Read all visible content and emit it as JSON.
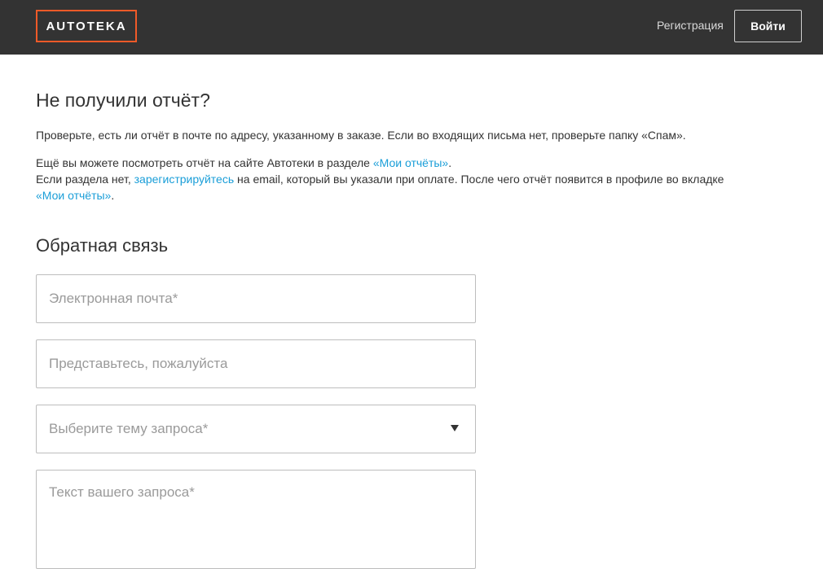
{
  "header": {
    "logo": "AUTOTEKA",
    "register_link": "Регистрация",
    "login_button": "Войти"
  },
  "main": {
    "title": "Не получили отчёт?",
    "paragraph1": "Проверьте, есть ли отчёт в почте по адресу, указанному в заказе. Если во входящих письма нет, проверьте папку «Спам».",
    "paragraph2": {
      "line1_text": "Ещё вы можете посмотреть отчёт на сайте Автотеки в разделе ",
      "line1_link": "«Мои отчёты»",
      "line1_end": ".",
      "line2_text": "Если раздела нет, ",
      "line2_link": "зарегистрируйтесь",
      "line2_end": " на email, который вы указали при оплате. После чего отчёт появится в профиле во вкладке",
      "line3_link": "«Мои отчёты»",
      "line3_end": "."
    },
    "feedback": {
      "title": "Обратная связь",
      "email_placeholder": "Электронная почта*",
      "name_placeholder": "Представьтесь, пожалуйста",
      "topic_placeholder": "Выберите тему запроса*",
      "message_placeholder": "Текст вашего запроса*"
    }
  },
  "colors": {
    "header_bg": "#333333",
    "logo_border": "#f05a28",
    "link": "#1a9ed8"
  }
}
